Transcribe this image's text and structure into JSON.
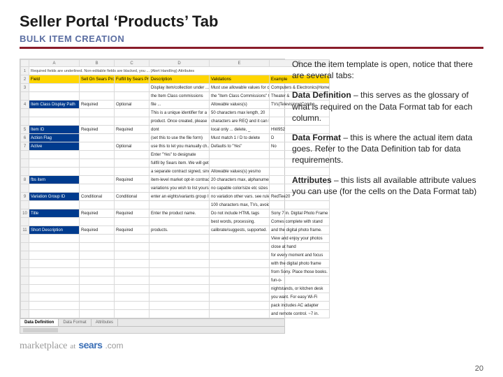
{
  "title": "Seller Portal ‘Products’ Tab",
  "subtitle": "BULK ITEM CREATION",
  "page_number": "20",
  "body": {
    "intro": "Once the item template is open, notice that there are several tabs:",
    "dd_label": "Data Definition",
    "dd_text": " – this serves as the glossary of what is required on the Data Format tab for each column.",
    "df_label": "Data Format",
    "df_text": " – this is where the actual item data goes.  Refer to the Data Definition tab for data requirements.",
    "attr_label": "Attributes",
    "attr_text": " – this lists all available attribute values you can use (for the cells on the Data Format tab)"
  },
  "brand": {
    "prefix": "marketplace",
    "at": "at",
    "word": "sears",
    "tld": ".com"
  },
  "spreadsheet": {
    "cols": [
      "",
      "A",
      "B",
      "C",
      "D",
      "E",
      "F"
    ],
    "note": "Required fields are underlined. Non-editable fields are blacked, you ... (Alert Handling) Attributes",
    "header": [
      "",
      "Field",
      "Sell On Sears Program",
      "Fulfill by Sears Program",
      "Description",
      "Validations",
      "Example"
    ],
    "rows": [
      {
        "num": "3",
        "a": "",
        "b": "",
        "c": "",
        "d": "Display item/collection under ...",
        "e": "Must use allowable values for cat...",
        "f": "Computers & Electronics|Home ..."
      },
      {
        "num": "",
        "a": "",
        "b": "",
        "c": "",
        "d": "the Item Class commissions",
        "e": "the \"Item Class Commissions\" table &",
        "f": "Theater &"
      },
      {
        "num": "4",
        "a": "Item Class Display Path",
        "b": "Required",
        "c": "Optional",
        "d": "file ...",
        "e": "Allowable values(s)",
        "f": "TVs|Televisions|Combo"
      },
      {
        "num": "",
        "a": "",
        "b": "",
        "c": "",
        "d": "This is a unique identifier for a",
        "e": "50 characters max length, 20",
        "f": ""
      },
      {
        "num": "",
        "a": "",
        "b": "",
        "c": "",
        "d": "product. Once created, please",
        "e": "characters are REQ and it can be",
        "f": ""
      },
      {
        "num": "5",
        "a": "Item ID",
        "b": "Required",
        "c": "Required",
        "d": "dont",
        "e": "local only ... delete, _",
        "f": "HW952"
      },
      {
        "num": "6",
        "a": "Action Flag",
        "b": "",
        "c": "",
        "d": "(set this to use the file form)",
        "e": "Must match 1 / D to delete",
        "f": "D"
      },
      {
        "num": "7",
        "a": "Active",
        "b": "",
        "c": "Optional",
        "d": "use this to let you manually ch...",
        "e": "Defaults to \"Yes\"",
        "f": "No"
      },
      {
        "num": "",
        "a": "",
        "b": "",
        "c": "",
        "d": "Enter \"Yes\" to designate",
        "e": "",
        "f": ""
      },
      {
        "num": "",
        "a": "",
        "b": "",
        "c": "",
        "d": "fullfil by Sears item. We will get",
        "e": "",
        "f": ""
      },
      {
        "num": "",
        "a": "",
        "b": "",
        "c": "",
        "d": "a separate contract signed, since",
        "e": "Allowable values(s) yes/no",
        "f": ""
      },
      {
        "num": "8",
        "a": "fbs item",
        "b": "",
        "c": "Required",
        "d": "item-level market opt-in contract.",
        "e": "20 characters max, alphanumeric",
        "f": ""
      },
      {
        "num": "",
        "a": "",
        "b": "",
        "c": "",
        "d": "variations you wish to list yourselves",
        "e": "no capable color/size etc sizes etc",
        "f": ""
      },
      {
        "num": "9",
        "a": "Variation Group ID",
        "b": "Conditional",
        "c": "Conditional",
        "d": "enter an eights/variants group ID for",
        "e": "no variation other vars. see ruleset",
        "f": "RedTee20"
      },
      {
        "num": "",
        "a": "",
        "b": "",
        "c": "",
        "d": "",
        "e": "100 characters max, TVs, avoid",
        "f": ""
      },
      {
        "num": "10",
        "a": "Title",
        "b": "Required",
        "c": "Required",
        "d": "Enter the product name.",
        "e": "Do not include HTML tags",
        "f": "Sony 7 in. Digital Photo Frame"
      },
      {
        "num": "",
        "a": "",
        "b": "",
        "c": "",
        "d": "",
        "e": "best words, processing.",
        "f": "Comes complete with stand"
      },
      {
        "num": "11",
        "a": "Short Description",
        "b": "Required",
        "c": "Required",
        "d": "products.",
        "e": "calibrate/suggests, supported.",
        "f": "and the digital photo frame."
      },
      {
        "num": "",
        "a": "",
        "b": "",
        "c": "",
        "d": "",
        "e": "",
        "f": "View and enjoy your photos"
      },
      {
        "num": "",
        "a": "",
        "b": "",
        "c": "",
        "d": "",
        "e": "",
        "f": "close at hand"
      },
      {
        "num": "",
        "a": "",
        "b": "",
        "c": "",
        "d": "",
        "e": "",
        "f": "for every moment and focus"
      },
      {
        "num": "",
        "a": "",
        "b": "",
        "c": "",
        "d": "",
        "e": "",
        "f": "with the digital photo frame"
      },
      {
        "num": "",
        "a": "",
        "b": "",
        "c": "",
        "d": "",
        "e": "",
        "f": "from Sony. Place those books."
      },
      {
        "num": "",
        "a": "",
        "b": "",
        "c": "",
        "d": "",
        "e": "",
        "f": "fun-o-"
      },
      {
        "num": "",
        "a": "",
        "b": "",
        "c": "",
        "d": "",
        "e": "",
        "f": "nightstands, or kitchen desk"
      },
      {
        "num": "",
        "a": "",
        "b": "",
        "c": "",
        "d": "",
        "e": "",
        "f": "you want. For easy Wi-Fi"
      },
      {
        "num": "",
        "a": "",
        "b": "",
        "c": "",
        "d": "",
        "e": "",
        "f": "pack includes AC adapter"
      },
      {
        "num": "",
        "a": "",
        "b": "",
        "c": "",
        "d": "",
        "e": "",
        "f": "and remote control. ~7 in."
      }
    ],
    "tabs": [
      {
        "label": "Data Definition",
        "active": true
      },
      {
        "label": "Data Format",
        "active": false
      },
      {
        "label": "Attributes",
        "active": false
      }
    ]
  }
}
